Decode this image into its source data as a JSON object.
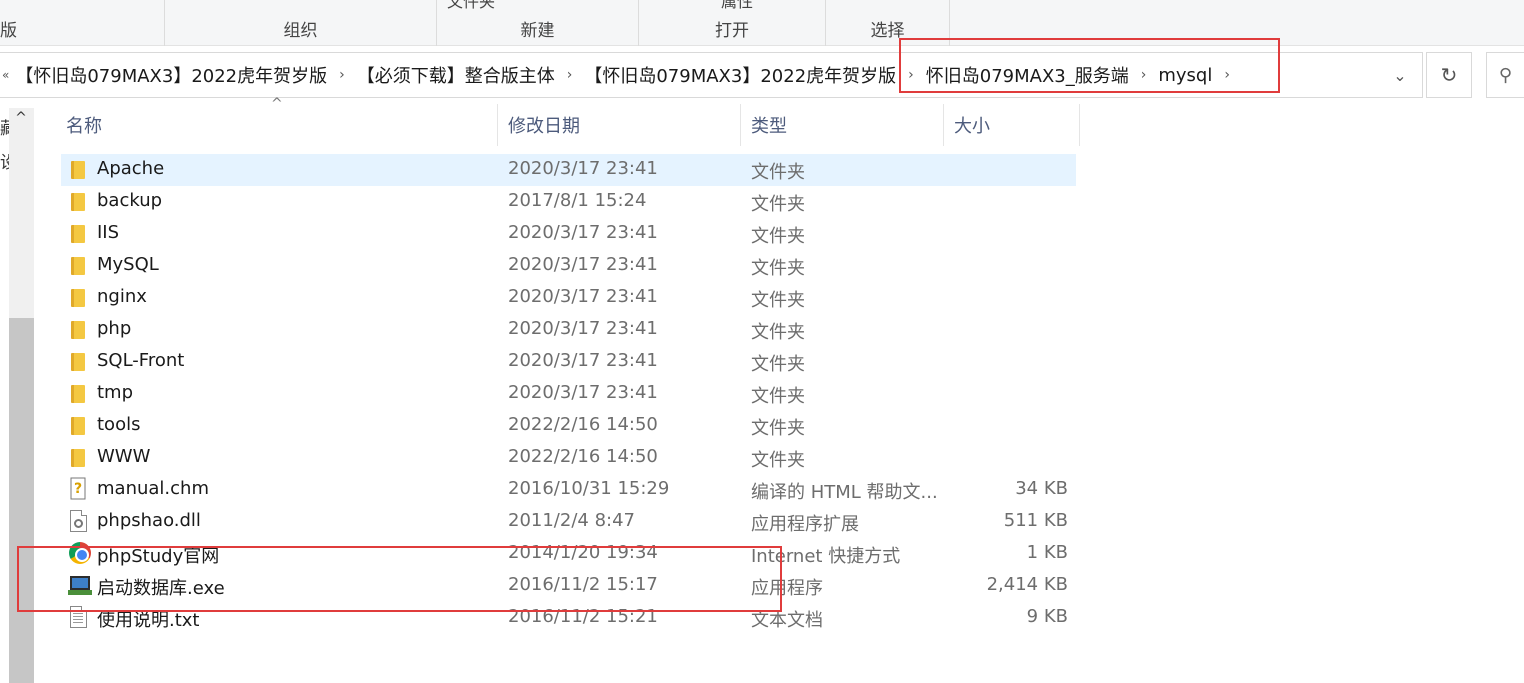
{
  "ribbon": {
    "left_fragment": "版",
    "top_fragment_1": "文件夹",
    "top_fragment_2": "属性",
    "groups": [
      "组织",
      "新建",
      "打开",
      "选择"
    ]
  },
  "address": {
    "crumbs": [
      "【怀旧岛079MAX3】2022虎年贺岁版",
      "【必须下载】整合版主体",
      "【怀旧岛079MAX3】2022虎年贺岁版",
      "怀旧岛079MAX3_服务端",
      "mysql"
    ],
    "separator": "›",
    "left_chevron": "«",
    "dropdown_icon": "⌄",
    "refresh_icon": "↻",
    "search_icon": "⚲"
  },
  "nav": {
    "fragments": [
      "藏",
      "设"
    ],
    "scroll_up": "^"
  },
  "columns": {
    "name": "名称",
    "date": "修改日期",
    "type": "类型",
    "size": "大小"
  },
  "files": [
    {
      "name": "Apache",
      "date": "2020/3/17 23:41",
      "type": "文件夹",
      "size": "",
      "icon": "folder-icon",
      "selected": true
    },
    {
      "name": "backup",
      "date": "2017/8/1 15:24",
      "type": "文件夹",
      "size": "",
      "icon": "folder-icon"
    },
    {
      "name": "IIS",
      "date": "2020/3/17 23:41",
      "type": "文件夹",
      "size": "",
      "icon": "folder-icon"
    },
    {
      "name": "MySQL",
      "date": "2020/3/17 23:41",
      "type": "文件夹",
      "size": "",
      "icon": "folder-icon"
    },
    {
      "name": "nginx",
      "date": "2020/3/17 23:41",
      "type": "文件夹",
      "size": "",
      "icon": "folder-icon"
    },
    {
      "name": "php",
      "date": "2020/3/17 23:41",
      "type": "文件夹",
      "size": "",
      "icon": "folder-icon"
    },
    {
      "name": "SQL-Front",
      "date": "2020/3/17 23:41",
      "type": "文件夹",
      "size": "",
      "icon": "folder-icon"
    },
    {
      "name": "tmp",
      "date": "2020/3/17 23:41",
      "type": "文件夹",
      "size": "",
      "icon": "folder-icon"
    },
    {
      "name": "tools",
      "date": "2022/2/16 14:50",
      "type": "文件夹",
      "size": "",
      "icon": "folder-icon"
    },
    {
      "name": "WWW",
      "date": "2022/2/16 14:50",
      "type": "文件夹",
      "size": "",
      "icon": "folder-icon"
    },
    {
      "name": "manual.chm",
      "date": "2016/10/31 15:29",
      "type": "编译的 HTML 帮助文...",
      "size": "34 KB",
      "icon": "help-file-icon"
    },
    {
      "name": "phpshao.dll",
      "date": "2011/2/4 8:47",
      "type": "应用程序扩展",
      "size": "511 KB",
      "icon": "dll-file-icon"
    },
    {
      "name": "phpStudy官网",
      "date": "2014/1/20 19:34",
      "type": "Internet 快捷方式",
      "size": "1 KB",
      "icon": "internet-shortcut-icon"
    },
    {
      "name": "启动数据库.exe",
      "date": "2016/11/2 15:17",
      "type": "应用程序",
      "size": "2,414 KB",
      "icon": "application-icon"
    },
    {
      "name": "使用说明.txt",
      "date": "2016/11/2 15:21",
      "type": "文本文档",
      "size": "9 KB",
      "icon": "text-file-icon"
    }
  ],
  "colors": {
    "annotation": "#e03c3c",
    "selection": "#e5f3ff",
    "header_text": "#4d5b7c"
  }
}
